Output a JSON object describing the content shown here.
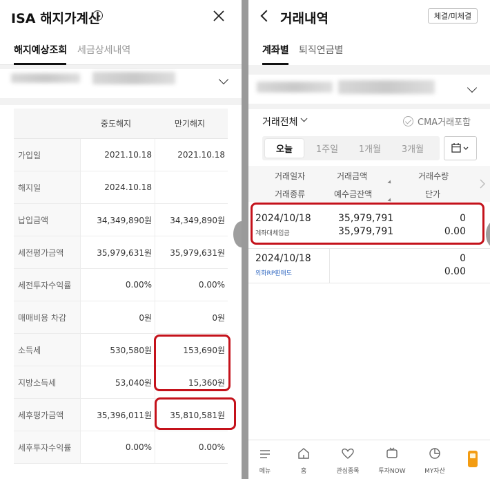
{
  "left": {
    "title": "ISA 해지가계산",
    "info_glyph": "!",
    "tabs": [
      "해지예상조회",
      "세금상세내역"
    ],
    "table": {
      "headers": [
        "중도해지",
        "만기해지"
      ],
      "rows": [
        {
          "label": "가입일",
          "mid": "2021.10.18",
          "end": "2021.10.18"
        },
        {
          "label": "해지일",
          "mid": "2024.10.18",
          "end": ""
        },
        {
          "label": "납입금액",
          "mid": "34,349,890원",
          "end": "34,349,890원"
        },
        {
          "label": "세전평가금액",
          "mid": "35,979,631원",
          "end": "35,979,631원"
        },
        {
          "label": "세전투자수익률",
          "mid": "0.00%",
          "end": "0.00%"
        },
        {
          "label": "매매비용 차감",
          "mid": "0원",
          "end": "0원"
        },
        {
          "label": "소득세",
          "mid": "530,580원",
          "end": "153,690원"
        },
        {
          "label": "지방소득세",
          "mid": "53,040원",
          "end": "15,360원"
        },
        {
          "label": "세후평가금액",
          "mid": "35,396,011원",
          "end": "35,810,581원"
        },
        {
          "label": "세후투자수익률",
          "mid": "0.00%",
          "end": "0.00%"
        }
      ]
    }
  },
  "right": {
    "title": "거래내역",
    "top_button": "체결/미체결",
    "tabs": [
      "계좌별",
      "퇴직연금별"
    ],
    "filter_label": "거래전체",
    "cma_label": "CMA거래포함",
    "periods": [
      "오늘",
      "1주일",
      "1개월",
      "3개월"
    ],
    "grid_headers": {
      "row1": [
        "거래일자",
        "거래금액",
        "거래수량"
      ],
      "row2": [
        "거래종류",
        "예수금잔액",
        "단가"
      ]
    },
    "transactions": [
      {
        "date": "2024/10/18",
        "type": "계좌대체입금",
        "amount": "35,979,791",
        "balance": "35,979,791",
        "qty": "0",
        "price": "0.00",
        "type_color": "#555555"
      },
      {
        "date": "2024/10/18",
        "type": "외화RP환매도",
        "amount": "",
        "balance": "",
        "qty": "0",
        "price": "0.00",
        "type_color": "#3a6fc4"
      }
    ],
    "nav": [
      "메뉴",
      "홈",
      "관심종목",
      "투자NOW",
      "MY자산"
    ]
  },
  "colors": {
    "highlight": "#c4121b",
    "accent": "#f39c12"
  }
}
